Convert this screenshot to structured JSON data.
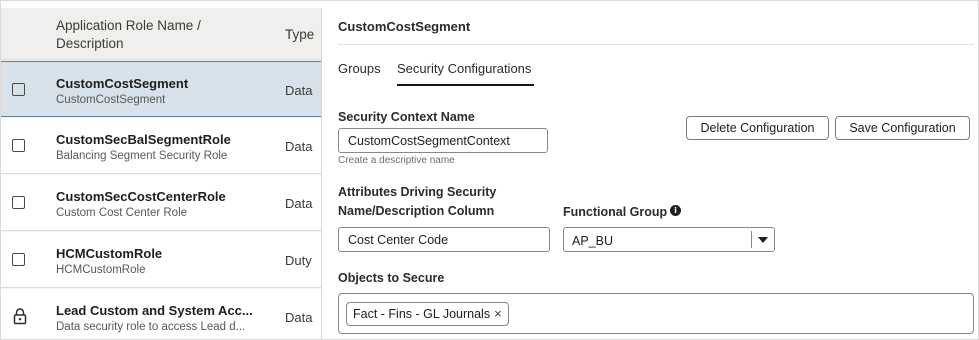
{
  "role_list": {
    "header": {
      "name_label": "Application Role Name / Description",
      "type_label": "Type"
    },
    "rows": [
      {
        "title": "CustomCostSegment",
        "description": "CustomCostSegment",
        "type": "Data",
        "selected": true,
        "icon": "checkbox-icon"
      },
      {
        "title": "CustomSecBalSegmentRole",
        "description": "Balancing Segment Security Role",
        "type": "Data",
        "selected": false,
        "icon": "checkbox-icon"
      },
      {
        "title": "CustomSecCostCenterRole",
        "description": "Custom Cost Center Role",
        "type": "Data",
        "selected": false,
        "icon": "checkbox-icon"
      },
      {
        "title": "HCMCustomRole",
        "description": "HCMCustomRole",
        "type": "Duty",
        "selected": false,
        "icon": "checkbox-icon"
      },
      {
        "title": "Lead Custom and System Acc...",
        "description": "Data security role to access Lead d...",
        "type": "Data",
        "selected": false,
        "icon": "lock-icon"
      }
    ]
  },
  "detail": {
    "title": "CustomCostSegment",
    "tabs": [
      {
        "label": "Groups",
        "active": false
      },
      {
        "label": "Security Configurations",
        "active": true
      }
    ],
    "security_context": {
      "label": "Security Context Name",
      "value": "CustomCostSegmentContext",
      "hint": "Create a descriptive name"
    },
    "buttons": {
      "delete_label": "Delete Configuration",
      "save_label": "Save Configuration"
    },
    "attributes": {
      "section_label": "Attributes Driving Security",
      "name_column_label": "Name/Description Column",
      "name_column_value": "Cost Center Code",
      "functional_group_label": "Functional Group",
      "functional_group_info_icon": "info-icon",
      "functional_group_value": "AP_BU"
    },
    "objects": {
      "label": "Objects to Secure",
      "chips": [
        {
          "label": "Fact - Fins - GL Journals",
          "remove_glyph": "×"
        }
      ]
    }
  }
}
